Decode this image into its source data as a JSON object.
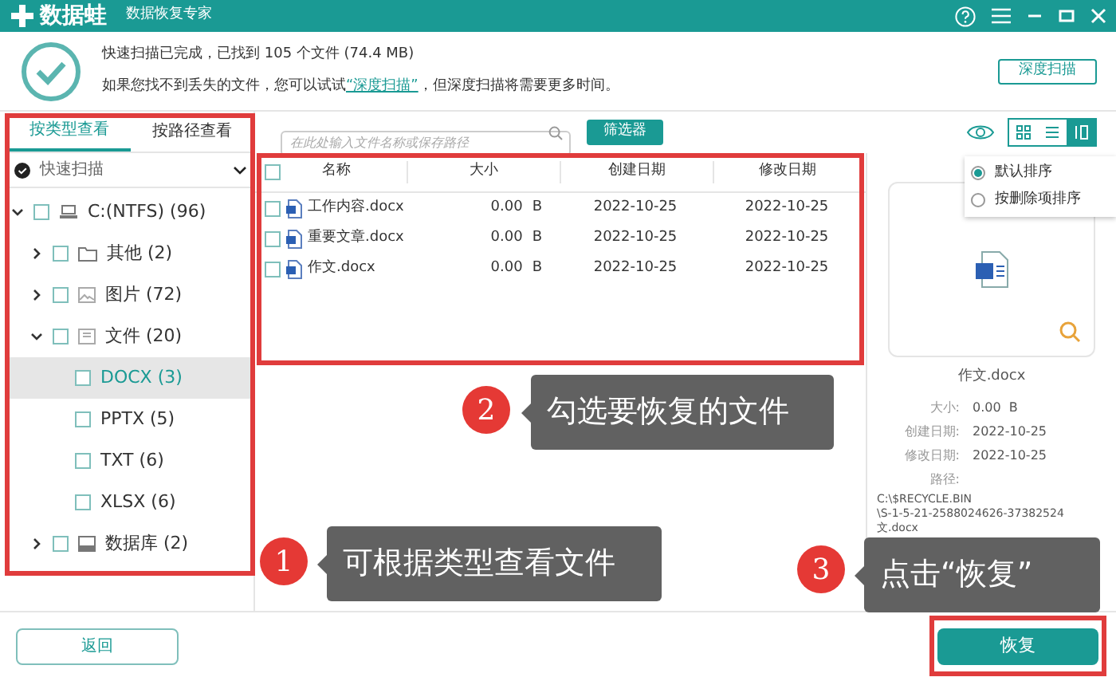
{
  "title_bar": {
    "app_name": "数据蛙",
    "subtitle": "数据恢复专家"
  },
  "scan_status": {
    "line1": "快速扫描已完成，已找到 105 个文件 (74.4 MB)",
    "line2_before": "如果您找不到丢失的文件，您可以试试",
    "line2_link": "“深度扫描”",
    "line2_after": "，但深度扫描将需要更多时间。",
    "button": "深度扫描"
  },
  "view_tabs": [
    {
      "label": "按类型查看",
      "selected": true
    },
    {
      "label": "按路径查看",
      "selected": false
    }
  ],
  "scan_mode": {
    "label": "快速扫描"
  },
  "tree": [
    {
      "label": "C:(NTFS) (96)",
      "kind": "drive",
      "checked": false,
      "selected": false,
      "expanded": true,
      "children": [
        {
          "label": "其他 (2)",
          "kind": "folder",
          "checked": false,
          "selected": false,
          "expanded": false
        },
        {
          "label": "图片 (72)",
          "kind": "image",
          "checked": false,
          "selected": false,
          "expanded": false
        },
        {
          "label": "文件 (20)",
          "kind": "document",
          "checked": false,
          "selected": false,
          "expanded": true,
          "children": [
            {
              "label": "DOCX (3)",
              "checked": false,
              "selected": true
            },
            {
              "label": "PPTX (5)",
              "checked": false,
              "selected": false
            },
            {
              "label": "TXT (6)",
              "checked": false,
              "selected": false
            },
            {
              "label": "XLSX (6)",
              "checked": false,
              "selected": false
            }
          ]
        },
        {
          "label": "数据库 (2)",
          "kind": "database",
          "checked": false,
          "selected": false,
          "expanded": false
        }
      ]
    }
  ],
  "search": {
    "placeholder": "在此处输入文件名称或保存路径"
  },
  "filter_button": "筛选器",
  "view_modes": [
    {
      "kind": "grid",
      "selected": false
    },
    {
      "kind": "list",
      "selected": false
    },
    {
      "kind": "detail",
      "selected": true
    }
  ],
  "sort_menu": [
    {
      "label": "默认排序",
      "selected": true
    },
    {
      "label": "按删除项排序",
      "selected": false
    }
  ],
  "table": {
    "select_all_checked": false,
    "columns": [
      "名称",
      "大小",
      "创建日期",
      "修改日期"
    ],
    "rows": [
      {
        "checked": false,
        "name": "工作内容.docx",
        "size": "0.00",
        "unit": "B",
        "created": "2022-10-25",
        "modified": "2022-10-25"
      },
      {
        "checked": false,
        "name": "重要文章.docx",
        "size": "0.00",
        "unit": "B",
        "created": "2022-10-25",
        "modified": "2022-10-25"
      },
      {
        "checked": false,
        "name": "作文.docx",
        "size": "0.00",
        "unit": "B",
        "created": "2022-10-25",
        "modified": "2022-10-25"
      }
    ]
  },
  "details": {
    "file_name": "作文.docx",
    "fields": [
      {
        "label": "大小:",
        "value": "0.00  B"
      },
      {
        "label": "创建日期:",
        "value": "2022-10-25"
      },
      {
        "label": "修改日期:",
        "value": "2022-10-25"
      }
    ],
    "path_label": "路径:",
    "path_lines": [
      "C:\\$RECYCLE.BIN",
      "\\S-1-5-21-2588024626-37382524",
      "文.docx"
    ]
  },
  "back_button": "返回",
  "recover_button": "恢复",
  "callouts": [
    {
      "number": "1",
      "text": "可根据类型查看文件"
    },
    {
      "number": "2",
      "text": "勾选要恢复的文件"
    },
    {
      "number": "3",
      "text": "点击“恢复”"
    }
  ]
}
